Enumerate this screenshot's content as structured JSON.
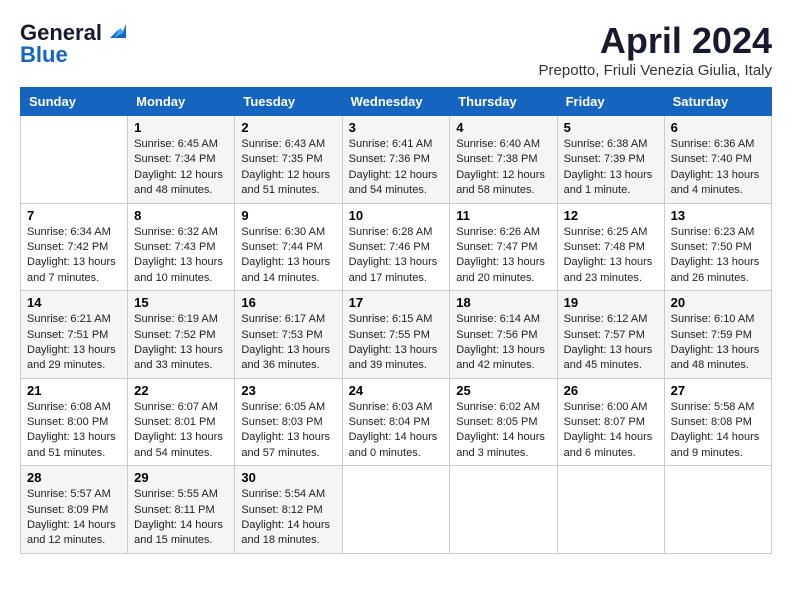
{
  "logo": {
    "line1": "General",
    "line2": "Blue"
  },
  "title": "April 2024",
  "subtitle": "Prepotto, Friuli Venezia Giulia, Italy",
  "days_of_week": [
    "Sunday",
    "Monday",
    "Tuesday",
    "Wednesday",
    "Thursday",
    "Friday",
    "Saturday"
  ],
  "weeks": [
    [
      {
        "day": "",
        "sunrise": "",
        "sunset": "",
        "daylight": ""
      },
      {
        "day": "1",
        "sunrise": "Sunrise: 6:45 AM",
        "sunset": "Sunset: 7:34 PM",
        "daylight": "Daylight: 12 hours and 48 minutes."
      },
      {
        "day": "2",
        "sunrise": "Sunrise: 6:43 AM",
        "sunset": "Sunset: 7:35 PM",
        "daylight": "Daylight: 12 hours and 51 minutes."
      },
      {
        "day": "3",
        "sunrise": "Sunrise: 6:41 AM",
        "sunset": "Sunset: 7:36 PM",
        "daylight": "Daylight: 12 hours and 54 minutes."
      },
      {
        "day": "4",
        "sunrise": "Sunrise: 6:40 AM",
        "sunset": "Sunset: 7:38 PM",
        "daylight": "Daylight: 12 hours and 58 minutes."
      },
      {
        "day": "5",
        "sunrise": "Sunrise: 6:38 AM",
        "sunset": "Sunset: 7:39 PM",
        "daylight": "Daylight: 13 hours and 1 minute."
      },
      {
        "day": "6",
        "sunrise": "Sunrise: 6:36 AM",
        "sunset": "Sunset: 7:40 PM",
        "daylight": "Daylight: 13 hours and 4 minutes."
      }
    ],
    [
      {
        "day": "7",
        "sunrise": "Sunrise: 6:34 AM",
        "sunset": "Sunset: 7:42 PM",
        "daylight": "Daylight: 13 hours and 7 minutes."
      },
      {
        "day": "8",
        "sunrise": "Sunrise: 6:32 AM",
        "sunset": "Sunset: 7:43 PM",
        "daylight": "Daylight: 13 hours and 10 minutes."
      },
      {
        "day": "9",
        "sunrise": "Sunrise: 6:30 AM",
        "sunset": "Sunset: 7:44 PM",
        "daylight": "Daylight: 13 hours and 14 minutes."
      },
      {
        "day": "10",
        "sunrise": "Sunrise: 6:28 AM",
        "sunset": "Sunset: 7:46 PM",
        "daylight": "Daylight: 13 hours and 17 minutes."
      },
      {
        "day": "11",
        "sunrise": "Sunrise: 6:26 AM",
        "sunset": "Sunset: 7:47 PM",
        "daylight": "Daylight: 13 hours and 20 minutes."
      },
      {
        "day": "12",
        "sunrise": "Sunrise: 6:25 AM",
        "sunset": "Sunset: 7:48 PM",
        "daylight": "Daylight: 13 hours and 23 minutes."
      },
      {
        "day": "13",
        "sunrise": "Sunrise: 6:23 AM",
        "sunset": "Sunset: 7:50 PM",
        "daylight": "Daylight: 13 hours and 26 minutes."
      }
    ],
    [
      {
        "day": "14",
        "sunrise": "Sunrise: 6:21 AM",
        "sunset": "Sunset: 7:51 PM",
        "daylight": "Daylight: 13 hours and 29 minutes."
      },
      {
        "day": "15",
        "sunrise": "Sunrise: 6:19 AM",
        "sunset": "Sunset: 7:52 PM",
        "daylight": "Daylight: 13 hours and 33 minutes."
      },
      {
        "day": "16",
        "sunrise": "Sunrise: 6:17 AM",
        "sunset": "Sunset: 7:53 PM",
        "daylight": "Daylight: 13 hours and 36 minutes."
      },
      {
        "day": "17",
        "sunrise": "Sunrise: 6:15 AM",
        "sunset": "Sunset: 7:55 PM",
        "daylight": "Daylight: 13 hours and 39 minutes."
      },
      {
        "day": "18",
        "sunrise": "Sunrise: 6:14 AM",
        "sunset": "Sunset: 7:56 PM",
        "daylight": "Daylight: 13 hours and 42 minutes."
      },
      {
        "day": "19",
        "sunrise": "Sunrise: 6:12 AM",
        "sunset": "Sunset: 7:57 PM",
        "daylight": "Daylight: 13 hours and 45 minutes."
      },
      {
        "day": "20",
        "sunrise": "Sunrise: 6:10 AM",
        "sunset": "Sunset: 7:59 PM",
        "daylight": "Daylight: 13 hours and 48 minutes."
      }
    ],
    [
      {
        "day": "21",
        "sunrise": "Sunrise: 6:08 AM",
        "sunset": "Sunset: 8:00 PM",
        "daylight": "Daylight: 13 hours and 51 minutes."
      },
      {
        "day": "22",
        "sunrise": "Sunrise: 6:07 AM",
        "sunset": "Sunset: 8:01 PM",
        "daylight": "Daylight: 13 hours and 54 minutes."
      },
      {
        "day": "23",
        "sunrise": "Sunrise: 6:05 AM",
        "sunset": "Sunset: 8:03 PM",
        "daylight": "Daylight: 13 hours and 57 minutes."
      },
      {
        "day": "24",
        "sunrise": "Sunrise: 6:03 AM",
        "sunset": "Sunset: 8:04 PM",
        "daylight": "Daylight: 14 hours and 0 minutes."
      },
      {
        "day": "25",
        "sunrise": "Sunrise: 6:02 AM",
        "sunset": "Sunset: 8:05 PM",
        "daylight": "Daylight: 14 hours and 3 minutes."
      },
      {
        "day": "26",
        "sunrise": "Sunrise: 6:00 AM",
        "sunset": "Sunset: 8:07 PM",
        "daylight": "Daylight: 14 hours and 6 minutes."
      },
      {
        "day": "27",
        "sunrise": "Sunrise: 5:58 AM",
        "sunset": "Sunset: 8:08 PM",
        "daylight": "Daylight: 14 hours and 9 minutes."
      }
    ],
    [
      {
        "day": "28",
        "sunrise": "Sunrise: 5:57 AM",
        "sunset": "Sunset: 8:09 PM",
        "daylight": "Daylight: 14 hours and 12 minutes."
      },
      {
        "day": "29",
        "sunrise": "Sunrise: 5:55 AM",
        "sunset": "Sunset: 8:11 PM",
        "daylight": "Daylight: 14 hours and 15 minutes."
      },
      {
        "day": "30",
        "sunrise": "Sunrise: 5:54 AM",
        "sunset": "Sunset: 8:12 PM",
        "daylight": "Daylight: 14 hours and 18 minutes."
      },
      {
        "day": "",
        "sunrise": "",
        "sunset": "",
        "daylight": ""
      },
      {
        "day": "",
        "sunrise": "",
        "sunset": "",
        "daylight": ""
      },
      {
        "day": "",
        "sunrise": "",
        "sunset": "",
        "daylight": ""
      },
      {
        "day": "",
        "sunrise": "",
        "sunset": "",
        "daylight": ""
      }
    ]
  ]
}
